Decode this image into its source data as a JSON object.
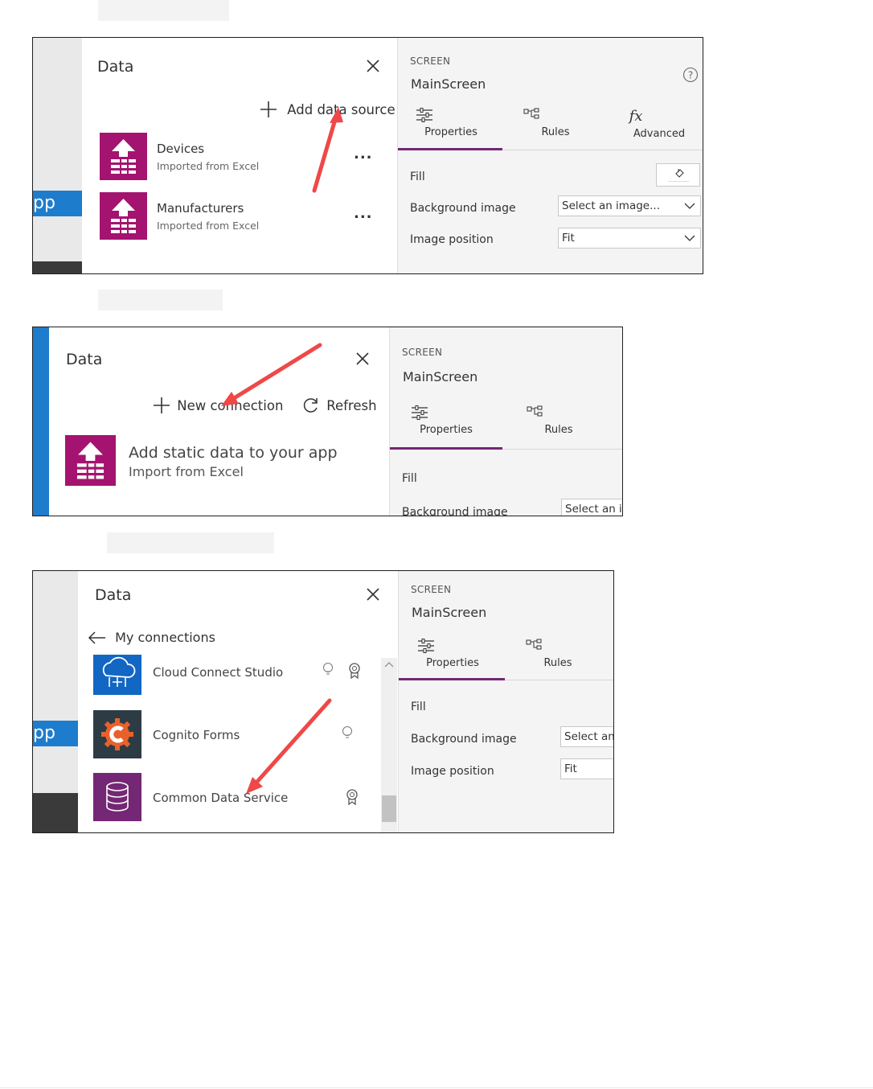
{
  "panel1": {
    "app_label": "pp",
    "data_title": "Data",
    "add_source_label": "Add data source",
    "sources": [
      {
        "name": "Devices",
        "subtitle": "Imported from Excel",
        "menu": "..."
      },
      {
        "name": "Manufacturers",
        "subtitle": "Imported from Excel",
        "menu": "..."
      }
    ],
    "screen_label": "SCREEN",
    "screen_name": "MainScreen",
    "tabs": [
      "Properties",
      "Rules",
      "Advanced"
    ],
    "props": {
      "fill_label": "Fill",
      "bg_label": "Background image",
      "bg_value": "Select an image...",
      "pos_label": "Image position",
      "pos_value": "Fit"
    }
  },
  "panel2": {
    "data_title": "Data",
    "new_connection_label": "New connection",
    "refresh_label": "Refresh",
    "static_title": "Add static data to your app",
    "static_sub": "Import from Excel",
    "screen_label": "SCREEN",
    "screen_name": "MainScreen",
    "tabs": [
      "Properties",
      "Rules"
    ],
    "props": {
      "fill_label": "Fill",
      "bg_label": "Background image",
      "bg_value": "Select an i"
    }
  },
  "panel3": {
    "app_label": "pp",
    "data_title": "Data",
    "back_label": "My connections",
    "connectors": [
      {
        "name": "Cloud Connect Studio",
        "color": "#1266c4"
      },
      {
        "name": "Cognito Forms",
        "color": "#2d3b45"
      },
      {
        "name": "Common Data Service",
        "color": "#742774"
      }
    ],
    "screen_label": "SCREEN",
    "screen_name": "MainScreen",
    "tabs": [
      "Properties",
      "Rules"
    ],
    "props": {
      "fill_label": "Fill",
      "bg_label": "Background image",
      "bg_value": "Select an",
      "pos_label": "Image position",
      "pos_value": "Fit"
    }
  },
  "colors": {
    "accent": "#742774",
    "excel_icon": "#a4136f",
    "app_bar": "#1e7ccc",
    "arrow": "#ef4848"
  }
}
